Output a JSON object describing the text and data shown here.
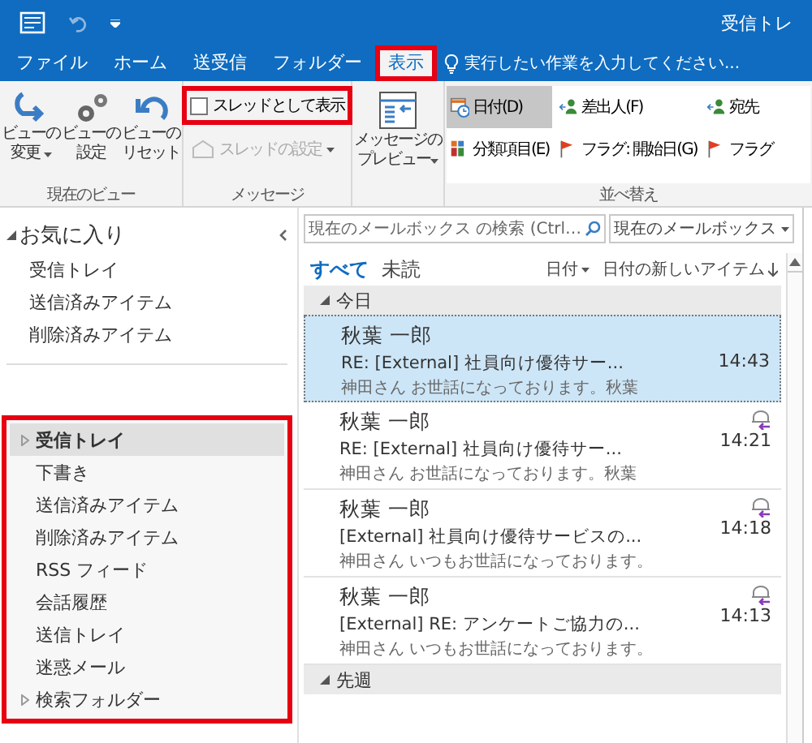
{
  "title_bar": {
    "title": "受信トレ"
  },
  "tabs": [
    {
      "label": "ファイル",
      "selected": false,
      "highlighted": false
    },
    {
      "label": "ホーム",
      "selected": false,
      "highlighted": false
    },
    {
      "label": "送受信",
      "selected": false,
      "highlighted": false
    },
    {
      "label": "フォルダー",
      "selected": false,
      "highlighted": false
    },
    {
      "label": "表示",
      "selected": true,
      "highlighted": true
    }
  ],
  "tell_me": {
    "placeholder": "実行したい作業を入力してください..."
  },
  "view_group": {
    "label": "現在のビュー",
    "buttons": [
      {
        "lines": [
          "ビューの",
          "変更"
        ],
        "dropdown": true
      },
      {
        "lines": [
          "ビューの",
          "設定"
        ],
        "dropdown": false
      },
      {
        "lines": [
          "ビューの",
          "リセット"
        ],
        "dropdown": false
      }
    ]
  },
  "message_group": {
    "label": "メッセージ",
    "thread_checkbox": {
      "label": "スレッドとして表示",
      "checked": false,
      "highlighted": true
    },
    "thread_settings": {
      "label": "スレッドの設定",
      "disabled": true,
      "dropdown": true
    }
  },
  "preview_button": {
    "lines": [
      "メッセージの",
      "プレビュー"
    ],
    "dropdown": true
  },
  "arrangement": {
    "label": "並べ替え",
    "options": [
      {
        "label": "日付(D)",
        "selected": true
      },
      {
        "label": "差出人(F)",
        "selected": false
      },
      {
        "label": "宛先",
        "selected": false
      },
      {
        "label": "分類項目(E)",
        "selected": false
      },
      {
        "label": "フラグ: 開始日(G)",
        "selected": false
      },
      {
        "label": "フラグ",
        "selected": false
      }
    ]
  },
  "navigation": {
    "favorites": {
      "label": "お気に入り",
      "expanded": true,
      "items": [
        {
          "label": "受信トレイ"
        },
        {
          "label": "送信済みアイテム"
        },
        {
          "label": "削除済みアイテム"
        }
      ]
    },
    "folders": {
      "highlighted": true,
      "items": [
        {
          "label": "受信トレイ",
          "selected": true,
          "has_children": true
        },
        {
          "label": "下書き",
          "selected": false,
          "has_children": false
        },
        {
          "label": "送信済みアイテム",
          "selected": false,
          "has_children": false
        },
        {
          "label": "削除済みアイテム",
          "selected": false,
          "has_children": false
        },
        {
          "label": "RSS フィード",
          "selected": false,
          "has_children": false
        },
        {
          "label": "会話履歴",
          "selected": false,
          "has_children": false
        },
        {
          "label": "送信トレイ",
          "selected": false,
          "has_children": false
        },
        {
          "label": "迷惑メール",
          "selected": false,
          "has_children": false
        },
        {
          "label": "検索フォルダー",
          "selected": false,
          "has_children": true
        }
      ]
    }
  },
  "search": {
    "placeholder": "現在のメールボックス の検索 (Ctrl…",
    "scope": "現在のメールボックス"
  },
  "filters": [
    {
      "label": "すべて",
      "selected": true
    },
    {
      "label": "未読",
      "selected": false
    }
  ],
  "sort": {
    "field": "日付",
    "order": "日付の新しいアイテム"
  },
  "message_groups": [
    {
      "label": "今日",
      "expanded": true,
      "messages": [
        {
          "sender": "秋葉 一郎",
          "subject": "RE: [External]  社員向け優待サー...",
          "preview": "神田さん  お世話になっております。秋葉",
          "time": "14:43",
          "selected": true,
          "replied": false
        },
        {
          "sender": "秋葉 一郎",
          "subject": "RE: [External]  社員向け優待サー...",
          "preview": "神田さん  お世話になっております。秋葉",
          "time": "14:21",
          "selected": false,
          "replied": true
        },
        {
          "sender": "秋葉 一郎",
          "subject": "[External]  社員向け優待サービスの...",
          "preview": "神田さん  いつもお世話になっております。",
          "time": "14:18",
          "selected": false,
          "replied": true
        },
        {
          "sender": "秋葉 一郎",
          "subject": "[External]  RE: アンケートご協力の...",
          "preview": "神田さん  いつもお世話になっております。",
          "time": "14:13",
          "selected": false,
          "replied": true
        }
      ]
    },
    {
      "label": "先週",
      "expanded": true
    }
  ]
}
